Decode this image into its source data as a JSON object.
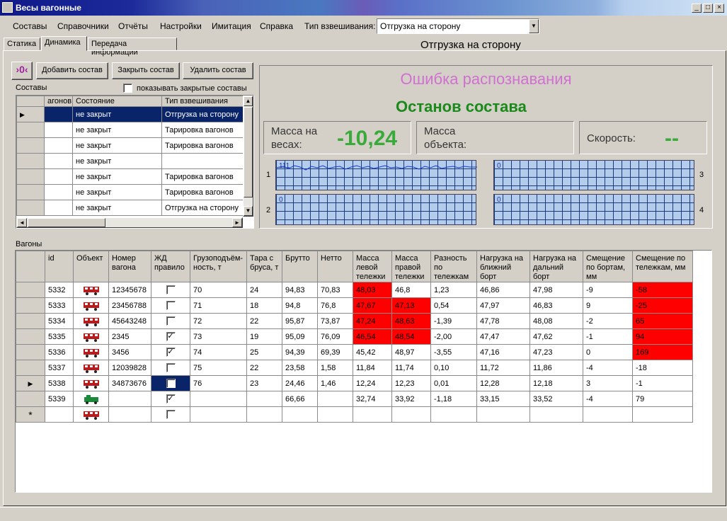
{
  "window": {
    "title": "Весы вагонные"
  },
  "menu": {
    "items": [
      "Составы",
      "Справочники",
      "Отчёты",
      "Настройки",
      "Имитация",
      "Справка"
    ],
    "weigh_type_label": "Тип взвешивания:",
    "weigh_type_value": "Отгрузка на сторону"
  },
  "tabs": [
    "Статика",
    "Динамика",
    "Передача информации"
  ],
  "header": {
    "title": "Отгрузка на сторону"
  },
  "toolbar": {
    "icon_text": "›0‹",
    "add": "Добавить состав",
    "close": "Закрыть состав",
    "delete": "Удалить состав"
  },
  "trains": {
    "label": "Составы",
    "show_closed_label": "показывать закрытые составы",
    "columns": [
      "агонов",
      "Состояние",
      "Тип взвешивания"
    ],
    "rows": [
      {
        "count": "",
        "state": "не закрыт",
        "type": "Отгрузка на сторону",
        "selected": true
      },
      {
        "count": "",
        "state": "не закрыт",
        "type": "Тарировка вагонов"
      },
      {
        "count": "",
        "state": "не закрыт",
        "type": "Тарировка вагонов"
      },
      {
        "count": "",
        "state": "не закрыт",
        "type": ""
      },
      {
        "count": "",
        "state": "не закрыт",
        "type": "Тарировка вагонов"
      },
      {
        "count": "",
        "state": "не закрыт",
        "type": "Тарировка вагонов"
      },
      {
        "count": "",
        "state": "не закрыт",
        "type": "Отгрузка на сторону"
      }
    ]
  },
  "status": {
    "error": "Ошибка распознавания",
    "stop": "Останов состава",
    "mass_label": "Масса на весах:",
    "mass_value": "-10,24",
    "object_label": "Масса объекта:",
    "speed_label": "Скорость:",
    "speed_value": "--"
  },
  "plots": [
    {
      "num": "1",
      "label": "111"
    },
    {
      "num": "3",
      "label": "0"
    },
    {
      "num": "2",
      "label": "0"
    },
    {
      "num": "4",
      "label": "0"
    }
  ],
  "wagons": {
    "label": "Вагоны",
    "columns": [
      "id",
      "Объект",
      "Номер вагона",
      "ЖД правило",
      "Грузоподъём-ность, т",
      "Тара с бруса, т",
      "Брутто",
      "Нетто",
      "Масса левой тележки",
      "Масса правой тележки",
      "Разность по тележкам",
      "Нагрузка на ближний борт",
      "Нагрузка на дальний борт",
      "Смещение по бортам, мм",
      "Смещение по тележкам, мм"
    ],
    "rows": [
      {
        "id": "5332",
        "num": "12345678",
        "rule": false,
        "cap": "70",
        "tare": "24",
        "gross": "94,83",
        "net": "70,83",
        "left": "48,03",
        "right": "46,8",
        "diff": "1,23",
        "near": "46,86",
        "far": "47,98",
        "sb": "-9",
        "st": "-58",
        "red": [
          "left",
          "st"
        ]
      },
      {
        "id": "5333",
        "num": "23456788",
        "rule": false,
        "cap": "71",
        "tare": "18",
        "gross": "94,8",
        "net": "76,8",
        "left": "47,67",
        "right": "47,13",
        "diff": "0,54",
        "near": "47,97",
        "far": "46,83",
        "sb": "9",
        "st": "-25",
        "red": [
          "left",
          "right",
          "st"
        ]
      },
      {
        "id": "5334",
        "num": "45643248",
        "rule": false,
        "cap": "72",
        "tare": "22",
        "gross": "95,87",
        "net": "73,87",
        "left": "47,24",
        "right": "48,63",
        "diff": "-1,39",
        "near": "47,78",
        "far": "48,08",
        "sb": "-2",
        "st": "65",
        "red": [
          "left",
          "right",
          "st"
        ]
      },
      {
        "id": "5335",
        "num": "2345",
        "rule": true,
        "cap": "73",
        "tare": "19",
        "gross": "95,09",
        "net": "76,09",
        "left": "46,54",
        "right": "48,54",
        "diff": "-2,00",
        "near": "47,47",
        "far": "47,62",
        "sb": "-1",
        "st": "94",
        "red": [
          "left",
          "right",
          "st"
        ]
      },
      {
        "id": "5336",
        "num": "3456",
        "rule": true,
        "cap": "74",
        "tare": "25",
        "gross": "94,39",
        "net": "69,39",
        "left": "45,42",
        "right": "48,97",
        "diff": "-3,55",
        "near": "47,16",
        "far": "47,23",
        "sb": "0",
        "st": "169",
        "red": [
          "st"
        ]
      },
      {
        "id": "5337",
        "num": "12039828",
        "rule": false,
        "cap": "75",
        "tare": "22",
        "gross": "23,58",
        "net": "1,58",
        "left": "11,84",
        "right": "11,74",
        "diff": "0,10",
        "near": "11,72",
        "far": "11,86",
        "sb": "-4",
        "st": "-18",
        "red": []
      },
      {
        "id": "5338",
        "num": "34873676",
        "rule": false,
        "cap": "76",
        "tare": "23",
        "gross": "24,46",
        "net": "1,46",
        "left": "12,24",
        "right": "12,23",
        "diff": "0,01",
        "near": "12,28",
        "far": "12,18",
        "sb": "3",
        "st": "-1",
        "red": [],
        "current": true
      },
      {
        "id": "5339",
        "num": "",
        "rule": true,
        "cap": "",
        "tare": "",
        "gross": "66,66",
        "net": "",
        "left": "32,74",
        "right": "33,92",
        "diff": "-1,18",
        "near": "33,15",
        "far": "33,52",
        "sb": "-4",
        "st": "79",
        "red": [],
        "loco": true
      },
      {
        "id": "",
        "num": "",
        "rule": false,
        "cap": "",
        "tare": "",
        "gross": "",
        "net": "",
        "left": "",
        "right": "",
        "diff": "",
        "near": "",
        "far": "",
        "sb": "",
        "st": "",
        "red": [],
        "new": true
      }
    ]
  },
  "colors": {
    "error": "#d070d0",
    "stop": "#1a8a1a",
    "value": "#3aaa3a",
    "highlight": "#ff0000",
    "selection": "#0a246a"
  }
}
